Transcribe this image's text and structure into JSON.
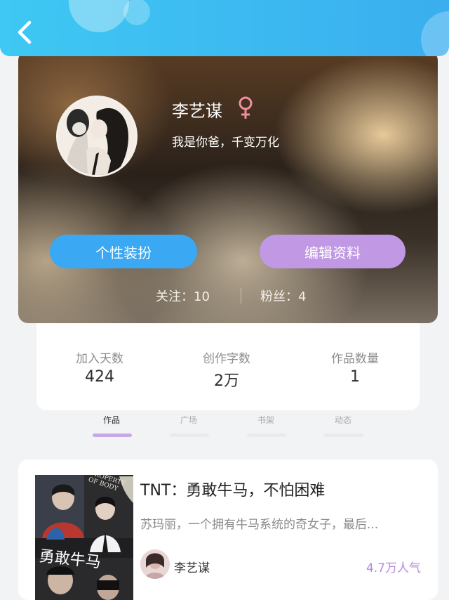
{
  "profile": {
    "name": "李艺谋",
    "gender_symbol": "♀",
    "bio": "我是你爸，千变万化"
  },
  "actions": {
    "personalize_label": "个性装扮",
    "edit_label": "编辑资料"
  },
  "social": {
    "following": "关注：10",
    "followers": "粉丝：4"
  },
  "stats": [
    {
      "label": "加入天数",
      "value": "424"
    },
    {
      "label": "创作字数",
      "value": "2万"
    },
    {
      "label": "作品数量",
      "value": "1"
    }
  ],
  "tabs": [
    {
      "label": "作品",
      "active": true
    },
    {
      "label": "广场",
      "active": false
    },
    {
      "label": "书架",
      "active": false
    },
    {
      "label": "动态",
      "active": false
    }
  ],
  "work": {
    "title": "TNT：勇敢牛马，不怕困难",
    "description": "苏玛丽，一个拥有牛马系统的奇女子，最后...",
    "author": "李艺谋",
    "popularity": "4.7万人气",
    "cover_text_top": "PROPERTY OF BODY",
    "cover_text_main": "勇敢牛马"
  },
  "colors": {
    "header": "#3fc8f3",
    "personalize_button": "#3aa8f2",
    "edit_button": "#c198e3",
    "popularity": "#b48bdc",
    "gender": "#f08f9e"
  }
}
